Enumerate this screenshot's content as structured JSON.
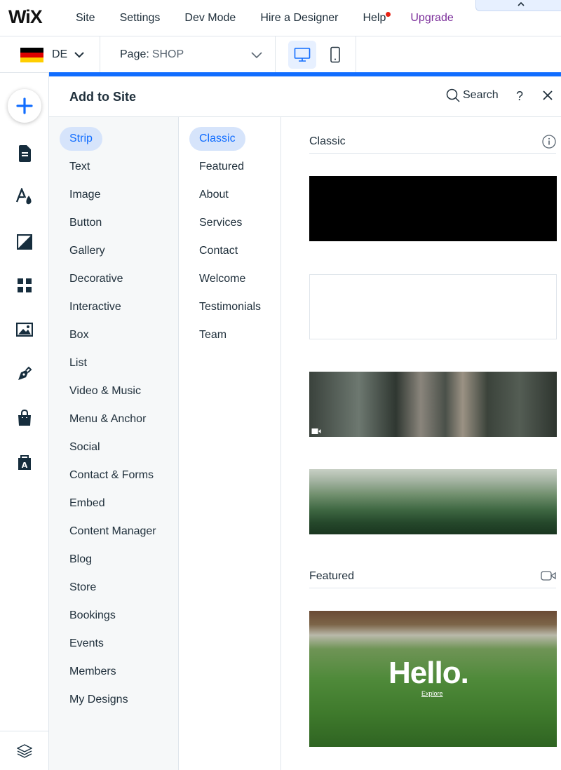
{
  "topbar": {
    "logo": "WiX",
    "nav": [
      {
        "label": "Site"
      },
      {
        "label": "Settings"
      },
      {
        "label": "Dev Mode"
      },
      {
        "label": "Hire a Designer"
      },
      {
        "label": "Help"
      },
      {
        "label": "Upgrade"
      }
    ],
    "collapse_icon": "chevron-up-icon"
  },
  "secondbar": {
    "language_code": "DE",
    "flag_colors": [
      "#000000",
      "#dd0000",
      "#ffce00"
    ],
    "page_label": "Page:",
    "page_value": "SHOP",
    "devices": [
      "desktop-icon",
      "mobile-icon"
    ]
  },
  "rail": {
    "icons": [
      "plus-icon",
      "pages-icon",
      "theme-icon",
      "background-icon",
      "apps-icon",
      "media-icon",
      "blog-pen-icon",
      "store-bag-icon",
      "portfolio-icon",
      "layers-icon"
    ]
  },
  "panel": {
    "title": "Add to Site",
    "search_label": "Search",
    "help_label": "?",
    "categories": [
      {
        "label": "Strip"
      },
      {
        "label": "Text"
      },
      {
        "label": "Image"
      },
      {
        "label": "Button"
      },
      {
        "label": "Gallery"
      },
      {
        "label": "Decorative"
      },
      {
        "label": "Interactive"
      },
      {
        "label": "Box"
      },
      {
        "label": "List"
      },
      {
        "label": "Video & Music"
      },
      {
        "label": "Menu & Anchor"
      },
      {
        "label": "Social"
      },
      {
        "label": "Contact & Forms"
      },
      {
        "label": "Embed"
      },
      {
        "label": "Content Manager"
      },
      {
        "label": "Blog"
      },
      {
        "label": "Store"
      },
      {
        "label": "Bookings"
      },
      {
        "label": "Events"
      },
      {
        "label": "Members"
      },
      {
        "label": "My Designs"
      }
    ],
    "subcategories": [
      {
        "label": "Classic"
      },
      {
        "label": "Featured"
      },
      {
        "label": "About"
      },
      {
        "label": "Services"
      },
      {
        "label": "Contact"
      },
      {
        "label": "Welcome"
      },
      {
        "label": "Testimonials"
      },
      {
        "label": "Team"
      }
    ],
    "sections": [
      {
        "title": "Classic"
      },
      {
        "title": "Featured"
      }
    ],
    "featured_thumb": {
      "headline": "Hello.",
      "link": "Explore"
    },
    "accent_color": "#116dff"
  }
}
